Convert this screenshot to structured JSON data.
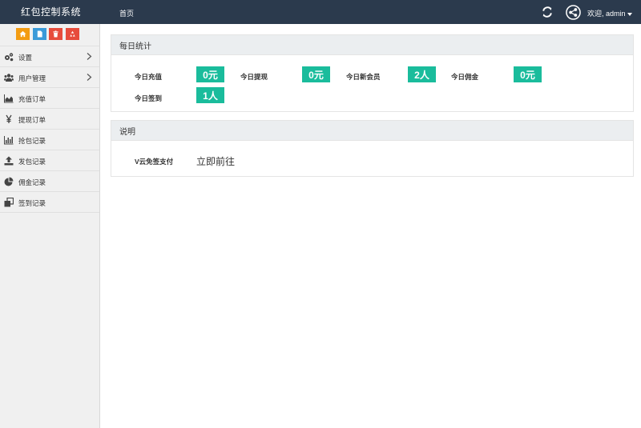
{
  "header": {
    "brand": "红包控制系统",
    "nav_home": "首页",
    "user_label": "欢迎, admin"
  },
  "sidebar": {
    "shortcuts": [
      {
        "icon": "home-icon",
        "color": "#f39c12"
      },
      {
        "icon": "document-icon",
        "color": "#3a9ad9"
      },
      {
        "icon": "trash-icon",
        "color": "#e74c3c"
      },
      {
        "icon": "recycle-icon",
        "color": "#e74c3c"
      }
    ],
    "items": [
      {
        "label": "设置",
        "icon": "gears-icon",
        "has_submenu": true
      },
      {
        "label": "用户管理",
        "icon": "users-icon",
        "has_submenu": true
      },
      {
        "label": "充值订单",
        "icon": "area-chart-icon",
        "has_submenu": false
      },
      {
        "label": "提现订单",
        "icon": "yen-icon",
        "has_submenu": false
      },
      {
        "label": "抢包记录",
        "icon": "bar-chart-icon",
        "has_submenu": false
      },
      {
        "label": "发包记录",
        "icon": "upload-icon",
        "has_submenu": false
      },
      {
        "label": "佣金记录",
        "icon": "pie-chart-icon",
        "has_submenu": false
      },
      {
        "label": "签到记录",
        "icon": "clone-icon",
        "has_submenu": false
      }
    ]
  },
  "daily_stats": {
    "title": "每日统计",
    "items": [
      {
        "label": "今日充值",
        "value": "0元"
      },
      {
        "label": "今日提现",
        "value": "0元"
      },
      {
        "label": "今日新会员",
        "value": "2人"
      },
      {
        "label": "今日佣金",
        "value": "0元"
      },
      {
        "label": "今日签到",
        "value": "1人"
      }
    ]
  },
  "notes": {
    "title": "说明",
    "label": "V云免签支付",
    "link_text": "立即前往"
  },
  "colors": {
    "topbar": "#2b3a4d",
    "badge": "#1abc9c",
    "sidebar_bg": "#f0f0f0"
  }
}
